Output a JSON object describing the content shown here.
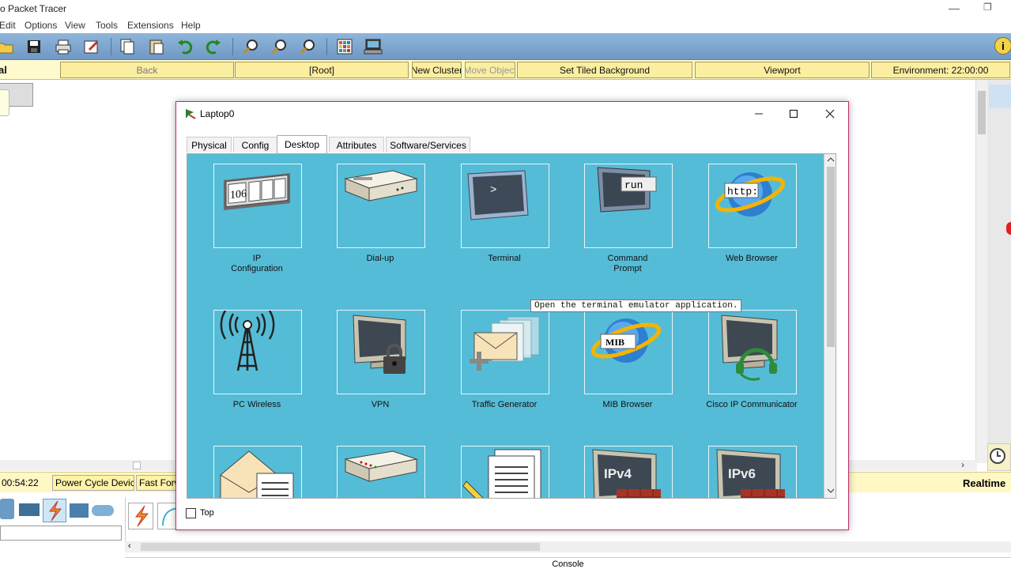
{
  "app": {
    "title": "co Packet Tracer",
    "min": "—",
    "restore": "❐"
  },
  "menu": [
    "Edit",
    "Options",
    "View",
    "Tools",
    "Extensions",
    "Help"
  ],
  "toolbar": {
    "info_label": "i"
  },
  "navbar": {
    "left_label": "al",
    "back": "Back",
    "root": "[Root]",
    "new_cluster": "New Cluster",
    "move_object": "Move Object",
    "set_tiled_background": "Set Tiled Background",
    "viewport": "Viewport",
    "environment": "Environment: 22:00:00"
  },
  "status": {
    "time": "00:54:22",
    "power_cycle": "Power Cycle Devices",
    "fast_forward": "Fast Forwa",
    "realtime": "Realtime"
  },
  "console_label": "Console",
  "dialog": {
    "title": "Laptop0",
    "tabs": [
      "Physical",
      "Config",
      "Desktop",
      "Attributes",
      "Software/Services"
    ],
    "active_tab": "Desktop",
    "apps_row1": [
      {
        "line1": "IP",
        "line2": "Configuration",
        "icon": "ip-config-icon"
      },
      {
        "line1": "Dial-up",
        "line2": "",
        "icon": "dialup-icon"
      },
      {
        "line1": "Terminal",
        "line2": "",
        "icon": "terminal-icon"
      },
      {
        "line1": "Command",
        "line2": "Prompt",
        "icon": "command-prompt-icon"
      },
      {
        "line1": "Web Browser",
        "line2": "",
        "icon": "web-browser-icon"
      }
    ],
    "apps_row2": [
      {
        "line1": "PC Wireless",
        "icon": "wireless-icon"
      },
      {
        "line1": "VPN",
        "icon": "vpn-icon"
      },
      {
        "line1": "Traffic Generator",
        "icon": "traffic-generator-icon"
      },
      {
        "line1": "MIB Browser",
        "icon": "mib-browser-icon"
      },
      {
        "line1": "Cisco IP Communicator",
        "icon": "ip-communicator-icon"
      }
    ],
    "icon_text": {
      "ip": "106",
      "terminal": ">",
      "run": "run",
      "http": "http:",
      "mib": "MIB",
      "ipv4": "IPv4",
      "ipv6": "IPv6"
    },
    "tooltip": "Open the terminal emulator application.",
    "top_checkbox_label": "Top",
    "top_checked": false
  }
}
